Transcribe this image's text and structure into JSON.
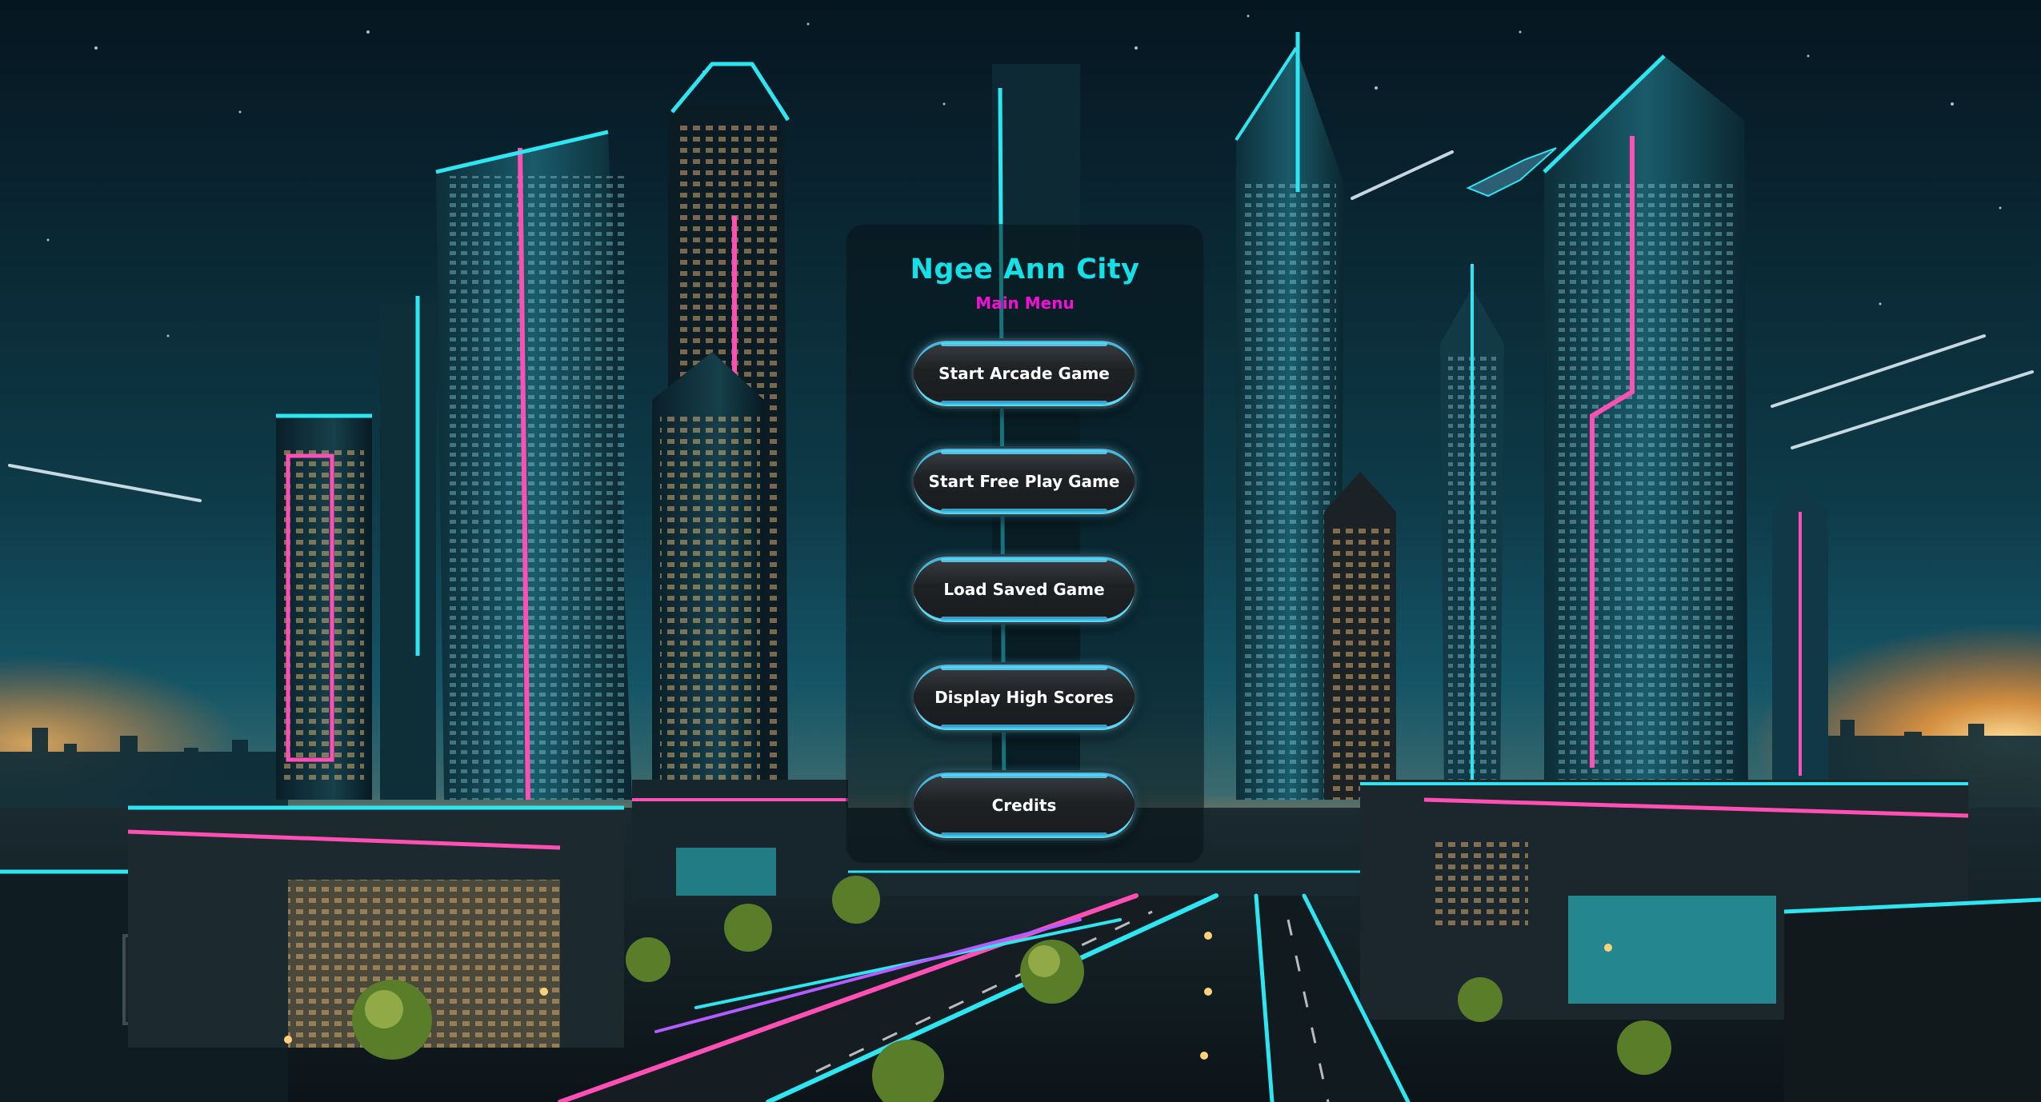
{
  "game": {
    "title": "Ngee Ann City",
    "subtitle": "Main Menu"
  },
  "menu": {
    "buttons": [
      {
        "id": "start-arcade",
        "label": "Start Arcade Game"
      },
      {
        "id": "start-free-play",
        "label": "Start Free Play Game"
      },
      {
        "id": "load-saved",
        "label": "Load Saved Game"
      },
      {
        "id": "high-scores",
        "label": "Display High Scores"
      },
      {
        "id": "credits",
        "label": "Credits"
      }
    ]
  },
  "colors": {
    "title": "#14e0e8",
    "subtitle": "#f20fd6",
    "button_text": "#ffffff",
    "button_glow": "#55d9f5",
    "neon_cyan": "#2ee6f2",
    "neon_pink": "#ff4fb4",
    "sky_top": "#071b24",
    "horizon_glow": "#ff9a2e"
  },
  "background": {
    "scene": "neon-futuristic-city-night"
  }
}
